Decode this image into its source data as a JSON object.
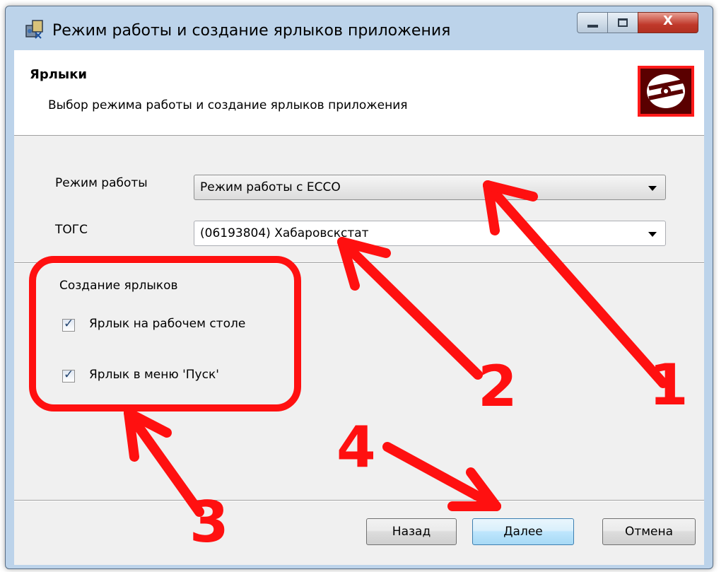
{
  "window": {
    "title": "Режим работы и создание ярлыков приложения",
    "controls": {
      "minimize": "",
      "maximize": "",
      "close": "X"
    }
  },
  "banner": {
    "title": "Ярлыки",
    "subtitle": "Выбор режима работы и создание ярлыков приложения",
    "logo_icon": "disc-icon"
  },
  "form": {
    "mode_label": "Режим работы",
    "mode_value": "Режим работы с ЕССО",
    "togs_label": "ТОГС",
    "togs_value": "(06193804) Хабаровскстат"
  },
  "shortcuts": {
    "group_label": "Создание ярлыков",
    "items": [
      {
        "label": "Ярлык на рабочем столе",
        "checked": true
      },
      {
        "label": "Ярлык в меню 'Пуск'",
        "checked": true
      }
    ]
  },
  "buttons": {
    "back": "Назад",
    "next": "Далее",
    "cancel": "Отмена"
  },
  "annotations": {
    "color": "#ff1010",
    "labels": [
      "1",
      "2",
      "3",
      "4"
    ]
  }
}
